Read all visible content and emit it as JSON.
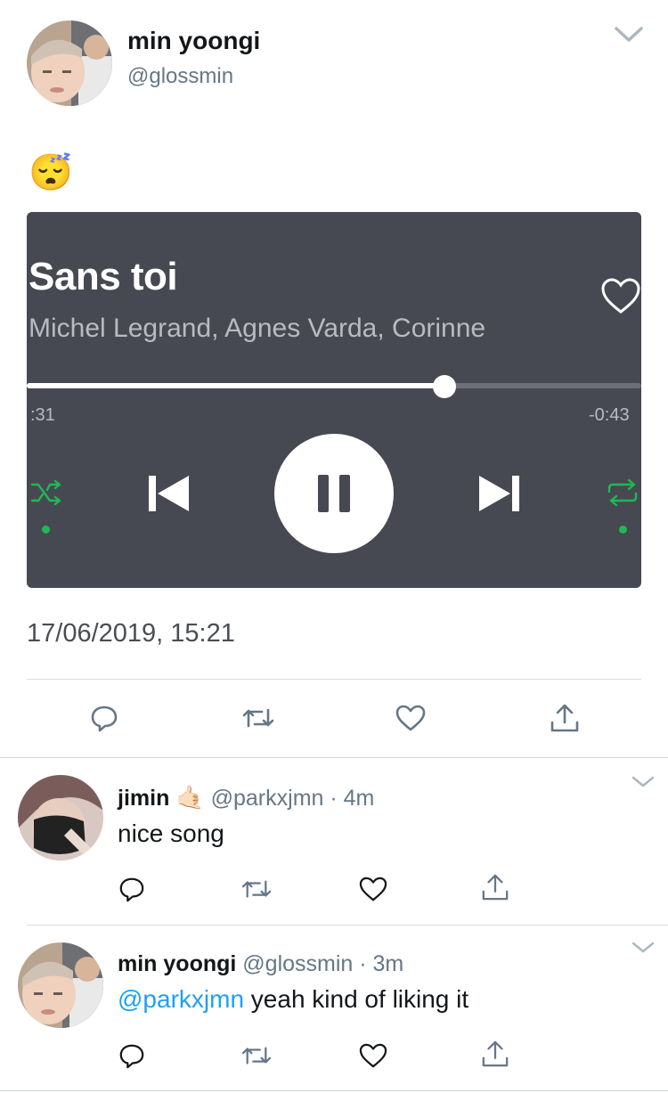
{
  "tweet": {
    "author_name": "min yoongi",
    "author_handle": "@glossmin",
    "emoji": "😴",
    "timestamp": "17/06/2019, 15:21",
    "player": {
      "song_title": "Sans toi",
      "artists": "Michel Legrand, Agnes Varda, Corinne",
      "elapsed": ":31",
      "remaining": "-0:43",
      "progress_fraction": 0.68,
      "shuffle_active": true,
      "repeat_active": true,
      "accent_color": "#1db954"
    }
  },
  "replies": [
    {
      "name": "jimin",
      "name_emoji": "🤙🏻",
      "handle": "@parkxjmn",
      "time": "4m",
      "text": "nice song"
    },
    {
      "name": "min yoongi",
      "handle": "@glossmin",
      "time": "3m",
      "mention": "@parkxjmn",
      "text": " yeah kind of liking it"
    }
  ],
  "separator": " · ",
  "colors": {
    "link": "#1da1f2",
    "text": "#14171a",
    "secondary": "#657786"
  },
  "icons": [
    "reply-icon",
    "retweet-icon",
    "like-icon",
    "share-icon",
    "chevron-down-icon"
  ]
}
